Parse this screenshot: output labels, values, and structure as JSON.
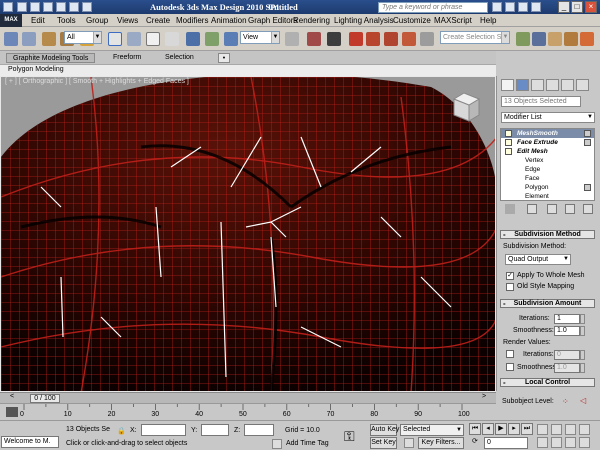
{
  "window": {
    "app_title": "Autodesk 3ds Max Design 2010 SP1",
    "doc_title": "Untitled",
    "search_placeholder": "Type a keyword or phrase"
  },
  "menu": {
    "logo": "MAX",
    "items": [
      "Edit",
      "Tools",
      "Group",
      "Views",
      "Create",
      "Modifiers",
      "Animation",
      "Graph Editors",
      "Rendering",
      "Lighting Analysis",
      "Customize",
      "MAXScript",
      "Help"
    ]
  },
  "toolbar": {
    "filter_value": "All",
    "refcoord_value": "View",
    "selection_set_placeholder": "Create Selection Set"
  },
  "ribbon": {
    "tabs": [
      "Graphite Modeling Tools",
      "Freeform",
      "Selection"
    ],
    "sub_label": "Polygon Modeling"
  },
  "viewport": {
    "label": "[ + ] [ Orthographic ] [ Smooth + Highlights + Edged Faces ]"
  },
  "command_panel": {
    "selection_info": "13 Objects Selected",
    "modifier_list": "Modifier List",
    "stack": [
      {
        "label": "MeshSmooth",
        "style": "selected"
      },
      {
        "label": "Face Extrude",
        "style": "bold"
      },
      {
        "label": "Edit Mesh",
        "style": "bold"
      },
      {
        "label": "Vertex",
        "style": "sub"
      },
      {
        "label": "Edge",
        "style": "sub"
      },
      {
        "label": "Face",
        "style": "sub"
      },
      {
        "label": "Polygon",
        "style": "sub"
      },
      {
        "label": "Element",
        "style": "sub"
      }
    ],
    "subdivision_method": {
      "title": "Subdivision Method",
      "label": "Subdivision Method:",
      "value": "Quad Output",
      "apply_whole": "Apply To Whole Mesh",
      "old_style": "Old Style Mapping"
    },
    "subdivision_amount": {
      "title": "Subdivision Amount",
      "iterations_label": "Iterations:",
      "iterations_value": "1",
      "smoothness_label": "Smoothness:",
      "smoothness_value": "1.0",
      "render_values": "Render Values:",
      "r_iterations_label": "Iterations:",
      "r_iterations_value": "0",
      "r_smoothness_label": "Smoothness:",
      "r_smoothness_value": "1.0"
    },
    "local_control": {
      "title": "Local Control",
      "subobject_label": "Subobject Level:"
    }
  },
  "timeline": {
    "slider": "0 / 100",
    "ticks": [
      "0",
      "10",
      "20",
      "30",
      "40",
      "50",
      "60",
      "70",
      "80",
      "90",
      "100"
    ],
    "current": 0,
    "total": 100
  },
  "status": {
    "maxscript": "Welcome to M.",
    "objects": "13 Objects Se",
    "x_label": "X:",
    "y_label": "Y:",
    "z_label": "Z:",
    "grid": "Grid = 10.0",
    "prompt": "Click or click-and-drag to select objects",
    "add_time_tag": "Add Time Tag",
    "auto_key": "Auto Key",
    "set_key": "Set Key",
    "key_mode": "Selected",
    "key_filters": "Key Filters...",
    "frame": "0"
  },
  "colors": {
    "viewport_bg": "#1a0300",
    "wire": "#c0201a",
    "selected_edges": "#ffffff",
    "title_bar": "#1d3a6e"
  }
}
